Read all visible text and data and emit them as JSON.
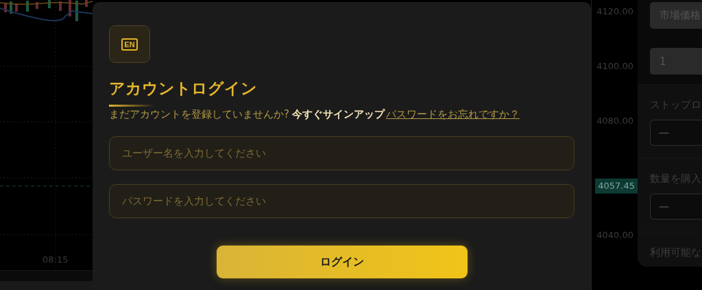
{
  "chart": {
    "time_label": "08:15"
  },
  "price_axis": {
    "items": [
      {
        "kind": "tick",
        "label": "4120.00"
      },
      {
        "kind": "tick",
        "label": "4100.00"
      },
      {
        "kind": "tick",
        "label": "4080.00"
      },
      {
        "kind": "current",
        "label": "4057.45"
      },
      {
        "kind": "tick",
        "label": "4040.00"
      }
    ]
  },
  "order_panel": {
    "sections": [
      {
        "fields": [
          {
            "kind": "filled",
            "value": "市場価格"
          },
          {
            "kind": "filled",
            "value": "1"
          }
        ]
      },
      {
        "label": "ストップロ",
        "fields": [
          {
            "kind": "outlined",
            "placeholder": "—"
          }
        ]
      },
      {
        "label": "数量を購入",
        "fields": [
          {
            "kind": "outlined",
            "placeholder": "—"
          }
        ]
      },
      {
        "label": "利用可能な"
      }
    ]
  },
  "login_modal": {
    "language_button": "EN",
    "title": "アカウントログイン",
    "prompt": "まだアカウントを登録していませんか?",
    "signup_link": "今すぐサインアップ",
    "forgot_link": "パスワードをお忘れですか？",
    "fields": [
      {
        "placeholder": "ユーザー名を入力してください"
      },
      {
        "placeholder": "パスワードを入力してください"
      }
    ],
    "submit_button": "ログイン"
  }
}
